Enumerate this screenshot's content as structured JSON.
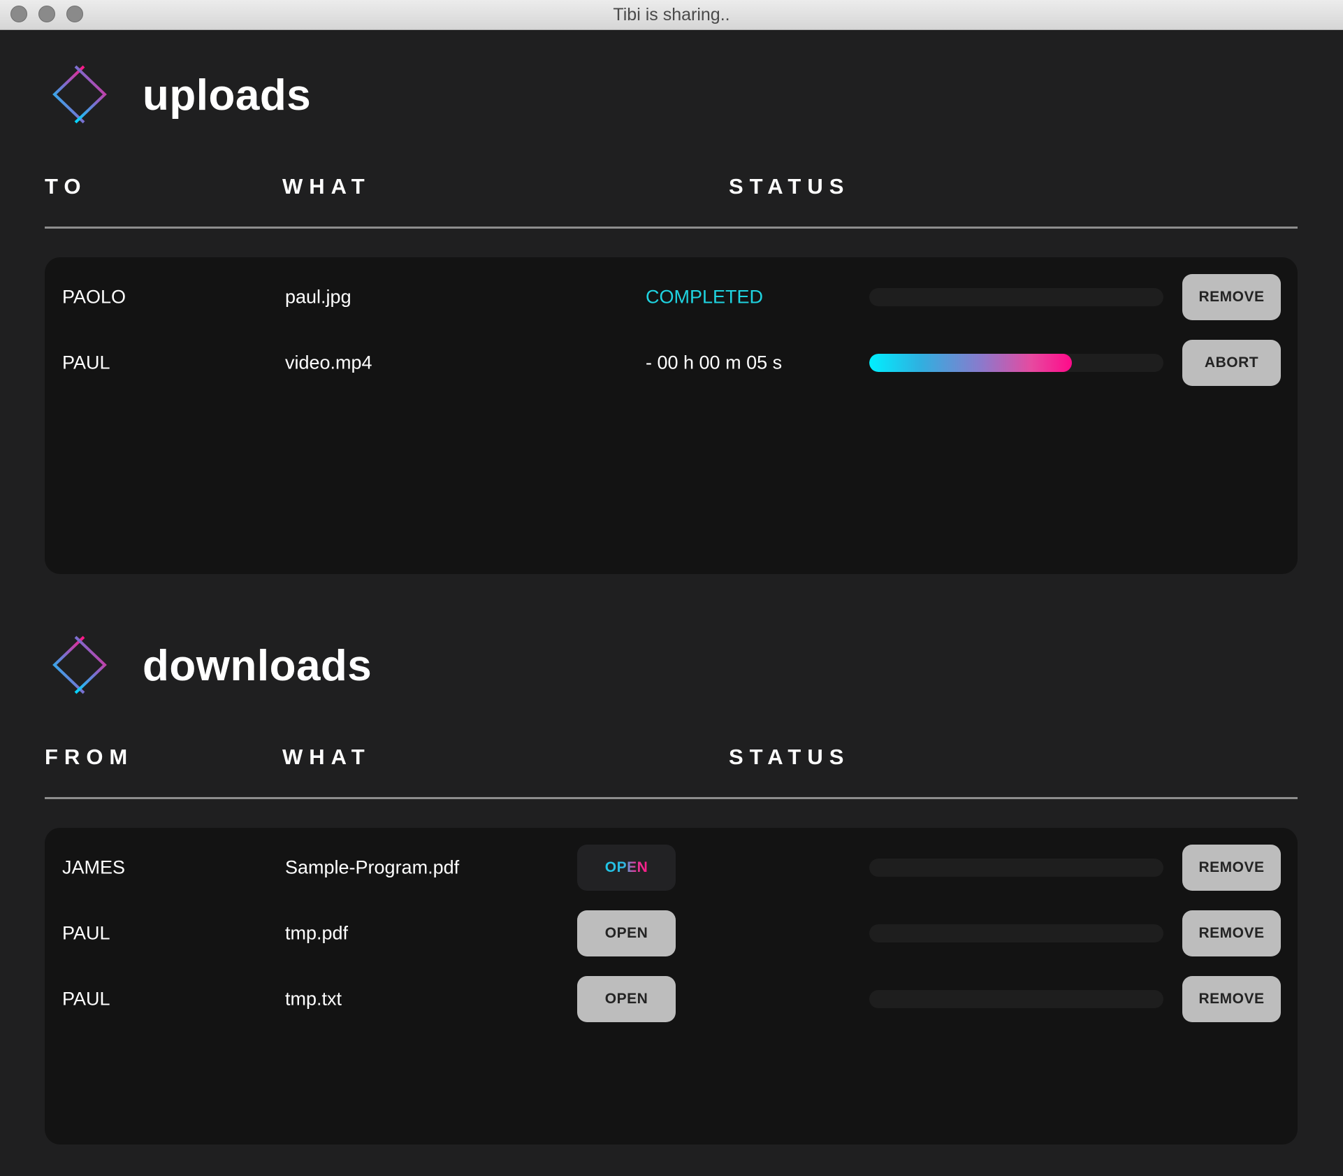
{
  "window": {
    "title": "Tibi is sharing.."
  },
  "colors": {
    "background": "#1f1f20",
    "panel": "#131313",
    "accent_cyan": "#1fd3e0",
    "accent_pink": "#ff0a8a",
    "button": "#bdbdbd"
  },
  "uploads": {
    "title": "uploads",
    "logo_icon": "exchange-diamond-icon",
    "columns": [
      "TO",
      "WHAT",
      "STATUS"
    ],
    "rows": [
      {
        "to": "PAOLO",
        "what": "paul.jpg",
        "status": "COMPLETED",
        "progress": 0,
        "action": "REMOVE"
      },
      {
        "to": "PAUL",
        "what": "video.mp4",
        "status": "- 00 h 00 m 05 s",
        "progress": 0.69,
        "action": "ABORT"
      }
    ]
  },
  "downloads": {
    "title": "downloads",
    "logo_icon": "exchange-diamond-icon",
    "columns": [
      "FROM",
      "WHAT",
      "STATUS"
    ],
    "rows": [
      {
        "from": "JAMES",
        "what": "Sample-Program.pdf",
        "open_label": "OPEN",
        "open_highlighted": true,
        "progress": 0,
        "action": "REMOVE"
      },
      {
        "from": "PAUL",
        "what": "tmp.pdf",
        "open_label": "OPEN",
        "open_highlighted": false,
        "progress": 0,
        "action": "REMOVE"
      },
      {
        "from": "PAUL",
        "what": "tmp.txt",
        "open_label": "OPEN",
        "open_highlighted": false,
        "progress": 0,
        "action": "REMOVE"
      }
    ]
  }
}
